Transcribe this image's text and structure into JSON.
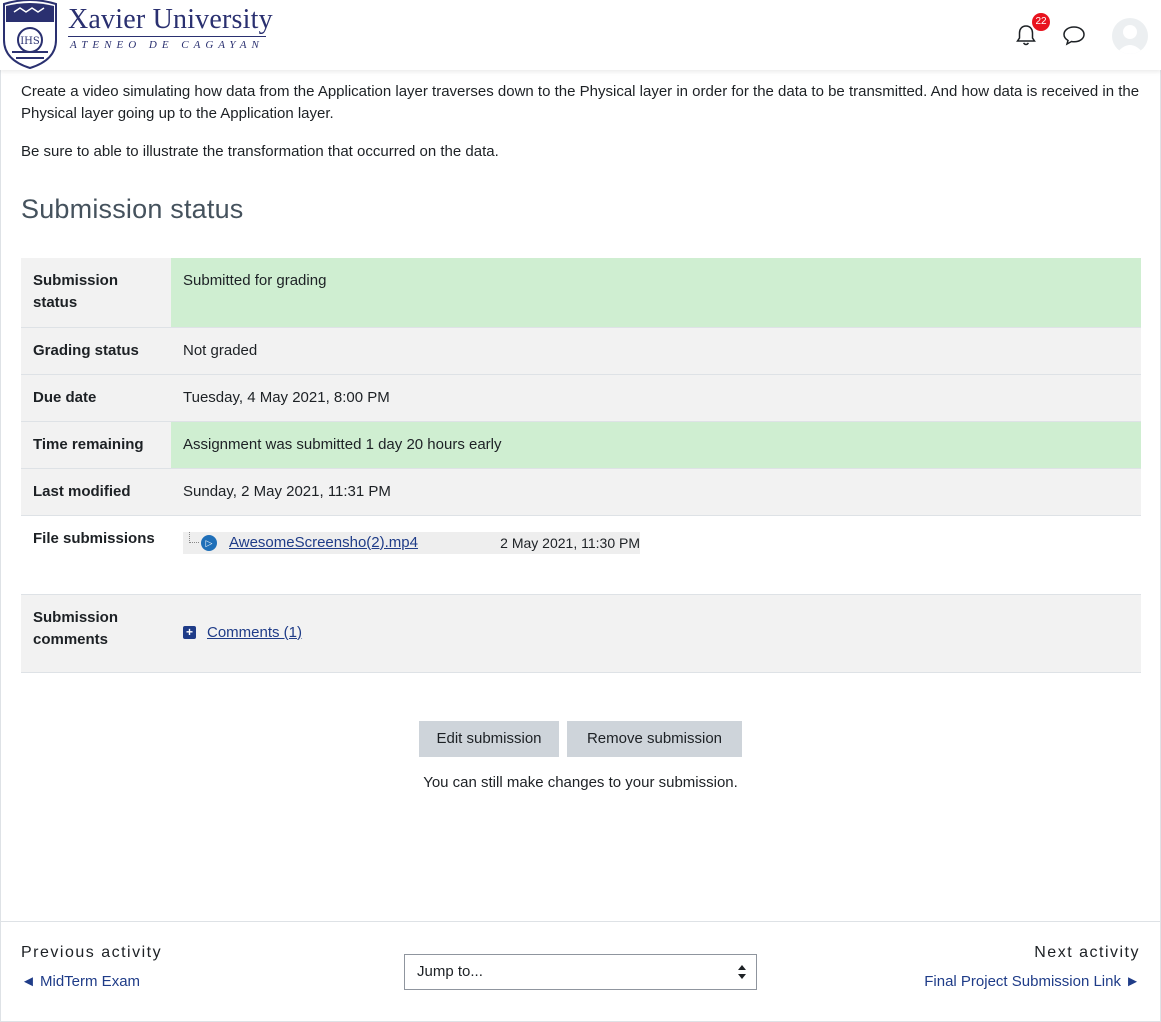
{
  "header": {
    "logo_title": "Xavier University",
    "logo_subtitle": "ATENEO DE CAGAYAN",
    "notifications_count": "22",
    "icons": [
      "bell-icon",
      "message-icon",
      "user-avatar-icon"
    ]
  },
  "intro": {
    "paragraph1": "Create a video simulating how data from the Application layer traverses down to the Physical layer in order for the data to be transmitted. And how data is received in the Physical layer going up to the Application layer.",
    "paragraph2": "Be sure to able to illustrate the transformation that occurred on the data."
  },
  "section_title": "Submission status",
  "status_table": {
    "submission_status_label": "Submission status",
    "submission_status_value": "Submitted for grading",
    "grading_status_label": "Grading status",
    "grading_status_value": "Not graded",
    "due_date_label": "Due date",
    "due_date_value": "Tuesday, 4 May 2021, 8:00 PM",
    "time_remaining_label": "Time remaining",
    "time_remaining_value": "Assignment was submitted 1 day 20 hours early",
    "last_modified_label": "Last modified",
    "last_modified_value": "Sunday, 2 May 2021, 11:31 PM",
    "file_submissions_label": "File submissions",
    "file_name": "AwesomeScreensho(2).mp4",
    "file_date": "2 May 2021, 11:30 PM",
    "submission_comments_label": "Submission comments",
    "comments_link": "Comments (1)"
  },
  "actions": {
    "edit_label": "Edit submission",
    "remove_label": "Remove submission",
    "note": "You can still make changes to your submission."
  },
  "footer": {
    "previous_label": "Previous activity",
    "previous_link": "◄ MidTerm Exam",
    "jump_placeholder": "Jump to...",
    "next_label": "Next activity",
    "next_link": "Final Project Submission Link ►"
  },
  "colors": {
    "brand": "#2a3070",
    "link": "#1f3c88",
    "success_bg": "#cfeed1",
    "badge": "#e8131e"
  }
}
